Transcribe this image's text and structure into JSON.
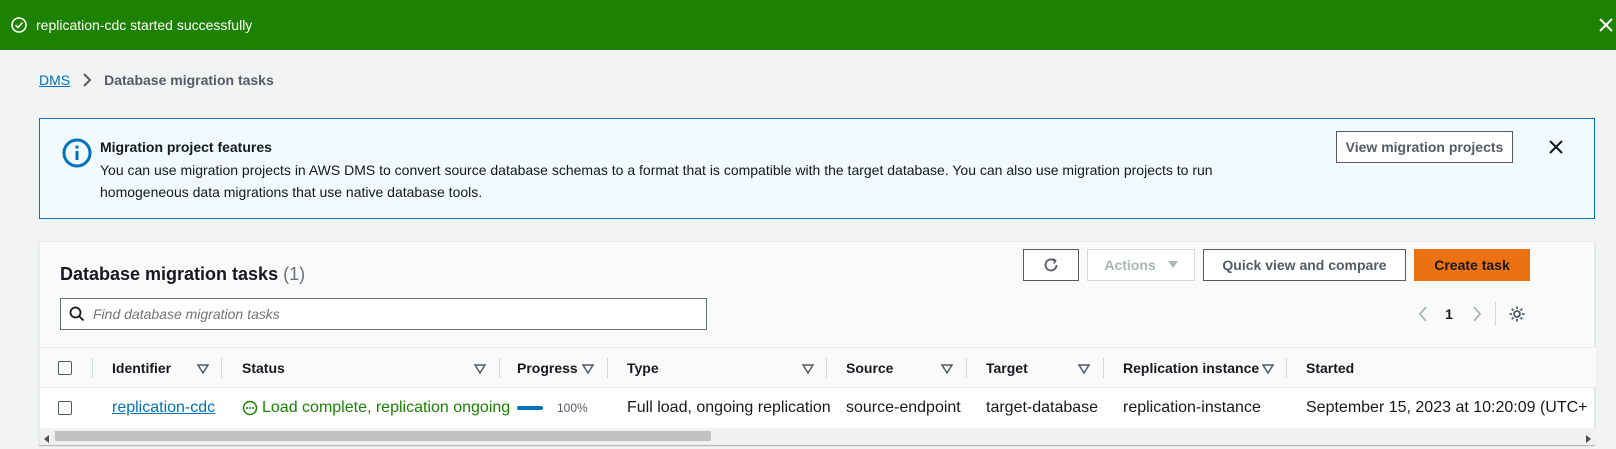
{
  "flash": {
    "message": "replication-cdc started successfully"
  },
  "breadcrumb": {
    "root": "DMS",
    "current": "Database migration tasks"
  },
  "info": {
    "title": "Migration project features",
    "body": "You can use migration projects in AWS DMS to convert source database schemas to a format that is compatible with the target database. You can also use migration projects to run homogeneous data migrations that use native database tools.",
    "view_button": "View migration projects"
  },
  "panel": {
    "title": "Database migration tasks",
    "count": "(1)",
    "actions": "Actions",
    "quick_view": "Quick view and compare",
    "create": "Create task",
    "search_placeholder": "Find database migration tasks",
    "page": "1"
  },
  "table": {
    "headers": [
      "Identifier",
      "Status",
      "Progress",
      "Type",
      "Source",
      "Target",
      "Replication instance",
      "Started"
    ],
    "rows": [
      {
        "identifier": "replication-cdc",
        "status": "Load complete, replication ongoing",
        "progress": "100%",
        "progress_value": 1.0,
        "type": "Full load, ongoing replication",
        "source": "source-endpoint",
        "target": "target-database",
        "instance": "replication-instance",
        "started": "September 15, 2023 at 10:20:09 (UTC+"
      }
    ]
  },
  "colors": {
    "success": "#1d8102",
    "link": "#0073bb",
    "primary": "#ec7211"
  }
}
